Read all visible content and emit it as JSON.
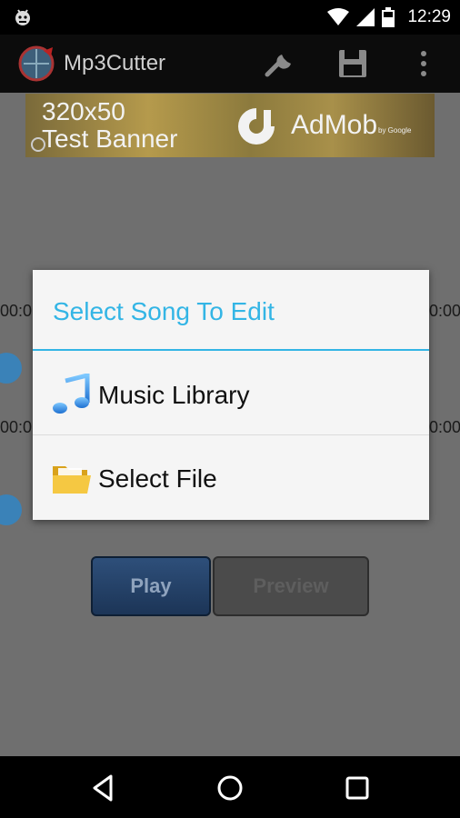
{
  "status_bar": {
    "time": "12:29",
    "icons": [
      "android-debug-icon",
      "wifi-icon",
      "signal-icon",
      "battery-icon"
    ]
  },
  "action_bar": {
    "title": "Mp3Cutter",
    "icons": [
      "app-logo",
      "settings-wrench-icon",
      "save-icon",
      "overflow-menu-icon"
    ]
  },
  "ad_banner": {
    "line1": "320x50",
    "line2": "Test Banner",
    "brand": "AdMob",
    "brand_small": "by Google"
  },
  "background": {
    "time_left_1": "00:0",
    "time_right_1": "0:00",
    "time_left_2": "00:0",
    "time_right_2": "0:00"
  },
  "buttons": {
    "play": "Play",
    "preview": "Preview"
  },
  "dialog": {
    "title": "Select Song To Edit",
    "items": [
      {
        "label": "Music Library",
        "icon": "music-note-icon"
      },
      {
        "label": "Select File",
        "icon": "folder-icon"
      }
    ]
  },
  "colors": {
    "accent": "#33b5e5",
    "dialog_bg": "#f5f5f5",
    "dim_bg": "#6f6f6f"
  },
  "nav_bar": {
    "icons": [
      "back-icon",
      "home-icon",
      "recents-icon"
    ]
  }
}
